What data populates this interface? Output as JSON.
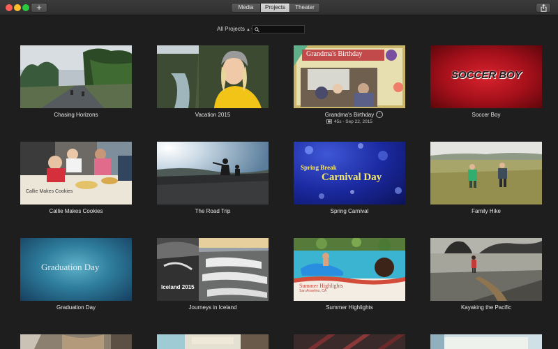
{
  "toolbar": {
    "add_label": "+",
    "tabs": [
      {
        "label": "Media",
        "active": false
      },
      {
        "label": "Projects",
        "active": true
      },
      {
        "label": "Theater",
        "active": false
      }
    ]
  },
  "filter": {
    "label": "All Projects",
    "search_placeholder": ""
  },
  "projects": [
    {
      "title": "Chasing  Horizons"
    },
    {
      "title": "Vacation 2015"
    },
    {
      "title": "Grandma's Birthday",
      "overlay": "Grandma's Birthday",
      "meta": "45s - Sep 22, 2015",
      "selected": true
    },
    {
      "title": "Soccer Boy",
      "overlay": "SOCCER BOY"
    },
    {
      "title": "Callie Makes Cookies",
      "overlay": "Callie Makes Cookies"
    },
    {
      "title": "The Road Trip"
    },
    {
      "title": "Spring Carnival",
      "overlay": "Spring Break",
      "overlay2": "Carnival Day"
    },
    {
      "title": "Family Hike"
    },
    {
      "title": "Graduation Day",
      "overlay": "Graduation Day"
    },
    {
      "title": "Journeys in Iceland",
      "overlay": "Iceland 2015"
    },
    {
      "title": "Summer Highlights",
      "overlay": "Summer Highlights",
      "overlay2": "San Anselmo, CA"
    },
    {
      "title": "Kayaking the Pacific"
    }
  ],
  "colors": {
    "background": "#1e1e1e",
    "soccer_red": "#b8121c",
    "carnival_blue": "#1d2fa0",
    "graduation_teal": "#2a7c9a"
  }
}
